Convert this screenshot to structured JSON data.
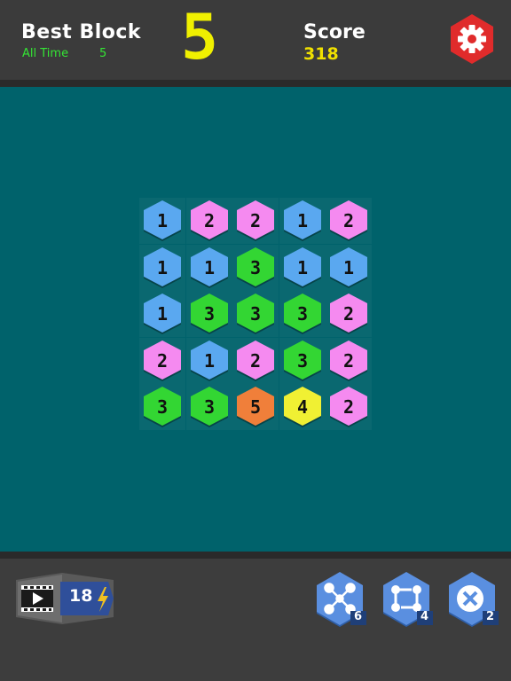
{
  "header": {
    "best_block_title": "Best Block",
    "all_time_label": "All Time",
    "all_time_value": "5",
    "current_block": "5",
    "score_title": "Score",
    "score_value": "318",
    "settings_icon": "gear-icon"
  },
  "board": {
    "rows": [
      [
        "1",
        "2",
        "2",
        "1",
        "2"
      ],
      [
        "1",
        "1",
        "3",
        "1",
        "1"
      ],
      [
        "1",
        "3",
        "3",
        "3",
        "2"
      ],
      [
        "2",
        "1",
        "2",
        "3",
        "2"
      ],
      [
        "3",
        "3",
        "5",
        "4",
        "2"
      ]
    ],
    "colors": {
      "1": "#5aa8f0",
      "2": "#f58af0",
      "3": "#33d633",
      "4": "#f0f033",
      "5": "#f07f3a"
    },
    "background": "#00626b"
  },
  "footer": {
    "video_icon": "film-play-icon",
    "video_energy": "18",
    "energy_icon": "lightning-icon",
    "tools": [
      {
        "name": "shuffle-tool",
        "icon": "shuffle-icon",
        "count": "6"
      },
      {
        "name": "swap-tool",
        "icon": "swap-icon",
        "count": "4"
      },
      {
        "name": "remove-tool",
        "icon": "close-icon",
        "count": "2"
      }
    ]
  }
}
